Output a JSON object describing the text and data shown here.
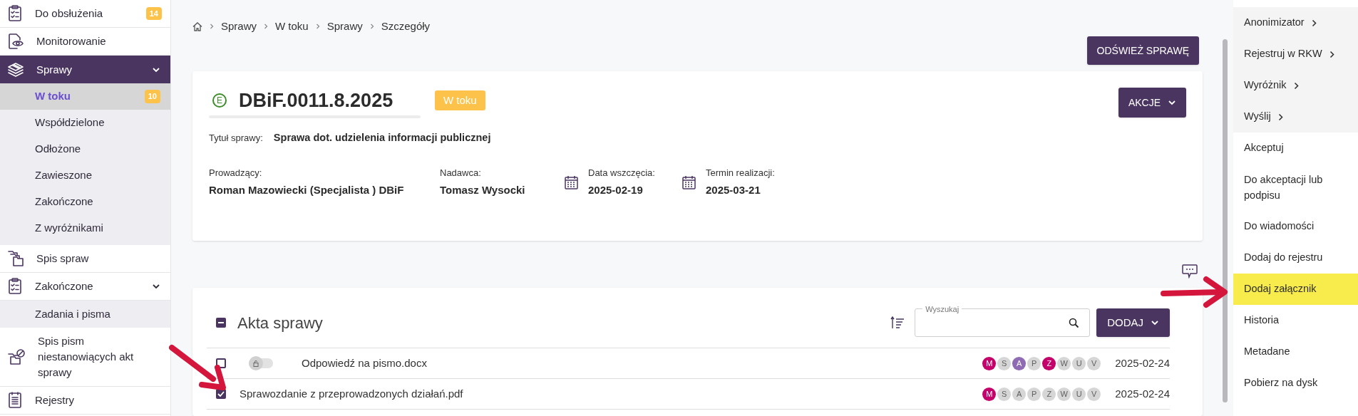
{
  "sidebar": {
    "items": [
      {
        "label": "Do obsłużenia",
        "badge": "14",
        "selected": false
      },
      {
        "label": "Monitorowanie",
        "selected": false
      },
      {
        "label": "Sprawy",
        "selected": true,
        "expanded": true,
        "children": [
          {
            "label": "W toku",
            "badge": "10",
            "selected": true
          },
          {
            "label": "Współdzielone",
            "selected": false
          },
          {
            "label": "Odłożone",
            "selected": false
          },
          {
            "label": "Zawieszone",
            "selected": false
          },
          {
            "label": "Zakończone",
            "selected": false
          },
          {
            "label": "Z wyróżnikami",
            "selected": false
          }
        ]
      },
      {
        "label": "Spis spraw",
        "selected": false
      },
      {
        "label": "Zakończone",
        "selected": false,
        "expanded": true,
        "children": [
          {
            "label": "Zadania i pisma",
            "selected": false
          }
        ]
      },
      {
        "label": "Spis pism niestanowiących akt sprawy",
        "selected": false
      },
      {
        "label": "Rejestry",
        "selected": false
      }
    ]
  },
  "breadcrumb": [
    "Sprawy",
    "W toku",
    "Sprawy",
    "Szczegóły"
  ],
  "refresh_button": "ODŚWIEŻ SPRAWĘ",
  "case": {
    "type_letter": "E",
    "number": "DBiF.0011.8.2025",
    "status": "W toku",
    "actions_button": "AKCJE",
    "title_label": "Tytuł sprawy:",
    "title": "Sprawa dot. udzielenia informacji publicznej",
    "fields": [
      {
        "kind": "plain",
        "label": "Prowadzący:",
        "value": "Roman Mazowiecki (Specjalista ) DBiF"
      },
      {
        "kind": "plain",
        "label": "Nadawca:",
        "value": "Tomasz Wysocki"
      },
      {
        "kind": "date",
        "label": "Data wszczęcia:",
        "value": "2025-02-19"
      },
      {
        "kind": "date",
        "label": "Termin realizacji:",
        "value": "2025-03-21"
      }
    ]
  },
  "files": {
    "title": "Akta sprawy",
    "indeterminate": true,
    "search": {
      "label": "Wyszukaj"
    },
    "add_button": "DODAJ",
    "rows": [
      {
        "checked": false,
        "toggle": {
          "on": false
        },
        "name": "Odpowiedź na pismo.docx",
        "date": "2025-02-24",
        "flags": [
          {
            "letter": "M",
            "color": "#c4006a"
          },
          {
            "letter": "S",
            "color": "#d6d6d6"
          },
          {
            "letter": "A",
            "color": "#8e6bb2"
          },
          {
            "letter": "P",
            "color": "#d6d6d6"
          },
          {
            "letter": "Z",
            "color": "#c4006a"
          },
          {
            "letter": "W",
            "color": "#d6d6d6"
          },
          {
            "letter": "U",
            "color": "#d6d6d6"
          },
          {
            "letter": "V",
            "color": "#d6d6d6"
          }
        ]
      },
      {
        "checked": true,
        "name": "Sprawozdanie z przeprowadzonych działań.pdf",
        "date": "2025-02-24",
        "flags": [
          {
            "letter": "M",
            "color": "#c4006a"
          },
          {
            "letter": "S",
            "color": "#d6d6d6"
          },
          {
            "letter": "A",
            "color": "#d6d6d6"
          },
          {
            "letter": "P",
            "color": "#d6d6d6"
          },
          {
            "letter": "Z",
            "color": "#d6d6d6"
          },
          {
            "letter": "W",
            "color": "#d6d6d6"
          },
          {
            "letter": "U",
            "color": "#d6d6d6"
          },
          {
            "letter": "V",
            "color": "#d6d6d6"
          }
        ]
      }
    ]
  },
  "actions_menu": {
    "items": [
      {
        "label": "Anonimizator",
        "submenu": true,
        "highlighted": false
      },
      {
        "label": "Rejestruj w RKW",
        "submenu": true,
        "highlighted": false
      },
      {
        "label": "Wyróżnik",
        "submenu": true,
        "highlighted": false
      },
      {
        "label": "Wyślij",
        "submenu": true,
        "highlighted": false
      },
      {
        "label": "Akceptuj",
        "submenu": false,
        "highlighted": false
      },
      {
        "label": "Do akceptacji lub podpisu",
        "submenu": false,
        "highlighted": false
      },
      {
        "label": "Do wiadomości",
        "submenu": false,
        "highlighted": false
      },
      {
        "label": "Dodaj do rejestru",
        "submenu": false,
        "highlighted": false
      },
      {
        "label": "Dodaj załącznik",
        "submenu": false,
        "highlighted": true
      },
      {
        "label": "Historia",
        "submenu": false,
        "highlighted": false
      },
      {
        "label": "Metadane",
        "submenu": false,
        "highlighted": false
      },
      {
        "label": "Pobierz na dysk",
        "submenu": false,
        "highlighted": false
      }
    ]
  }
}
